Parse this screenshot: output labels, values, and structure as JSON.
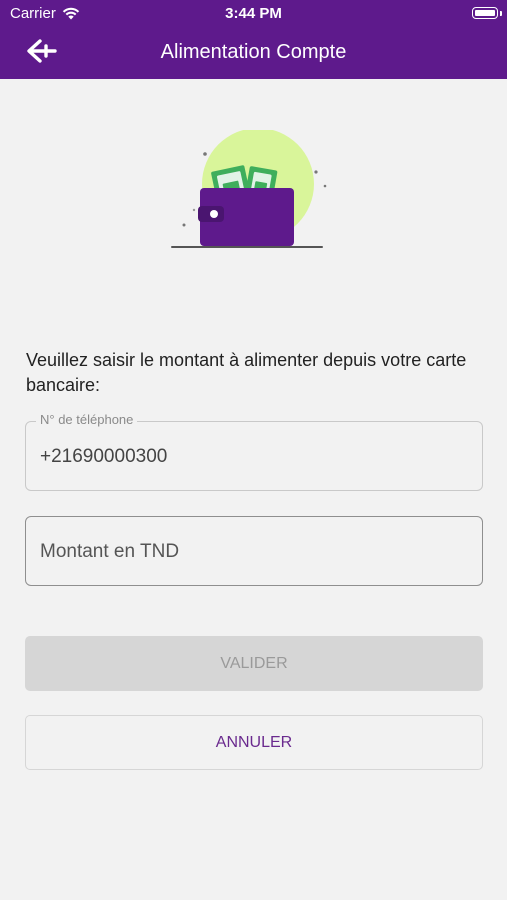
{
  "status_bar": {
    "carrier": "Carrier",
    "time": "3:44 PM",
    "wifi_icon": "wifi-icon",
    "battery_icon": "battery-icon"
  },
  "header": {
    "title": "Alimentation Compte",
    "back_icon": "arrow-left-icon",
    "background": "#5e1a8c"
  },
  "illustration": {
    "icon": "wallet-with-cash-icon",
    "wallet_color": "#5e1a8c",
    "circle_color": "#d9f59a",
    "bill_color": "#3fae5c"
  },
  "form": {
    "prompt": "Veuillez saisir le montant à alimenter depuis votre carte bancaire:",
    "phone_label": "N° de téléphone",
    "phone_value": "+21690000300",
    "amount_placeholder": "Montant en TND"
  },
  "buttons": {
    "validate_label": "VALIDER",
    "cancel_label": "ANNULER",
    "accent": "#6a2a8e"
  }
}
